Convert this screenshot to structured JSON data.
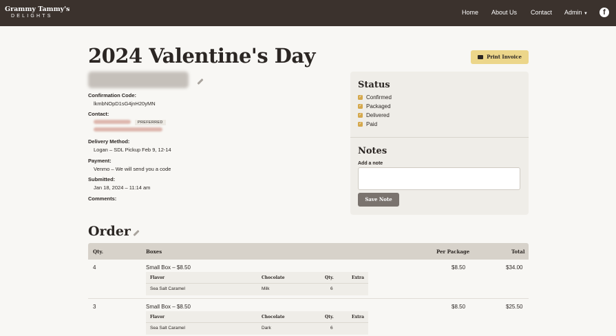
{
  "nav": {
    "brand_name": "Grammy Tammy's",
    "brand_sub": "DELIGHTS",
    "links": [
      "Home",
      "About Us",
      "Contact",
      "Admin"
    ],
    "facebook_glyph": "f"
  },
  "page": {
    "title": "2024 Valentine's Day",
    "print_label": "Print Invoice"
  },
  "order_info": {
    "confirmation_label": "Confirmation Code:",
    "confirmation_code": "lkmbNOpD1sG4jnH20yMN",
    "contact_label": "Contact:",
    "preferred_badge": "PREFERRED",
    "delivery_label": "Delivery Method:",
    "delivery_value": "Logan – SDL Pickup Feb 9, 12-14",
    "payment_label": "Payment:",
    "payment_value": "Venmo – We will send you a code",
    "submitted_label": "Submitted:",
    "submitted_value": "Jan 18, 2024 – 11:14 am",
    "comments_label": "Comments:"
  },
  "status": {
    "heading": "Status",
    "items": [
      "Confirmed",
      "Packaged",
      "Delivered",
      "Paid"
    ]
  },
  "notes": {
    "heading": "Notes",
    "add_label": "Add a note",
    "save_label": "Save Note"
  },
  "order": {
    "heading": "Order",
    "columns": [
      "Qty.",
      "Boxes",
      "Per Package",
      "Total"
    ],
    "sub_columns": [
      "Flavor",
      "Chocolate",
      "Qty.",
      "Extra"
    ],
    "rows": [
      {
        "qty": "4",
        "box": "Small Box – $8.50",
        "per_package": "$8.50",
        "total": "$34.00",
        "sub": {
          "flavor": "Sea Salt Caramel",
          "chocolate": "Milk",
          "qty": "6",
          "extra": ""
        }
      },
      {
        "qty": "3",
        "box": "Small Box – $8.50",
        "per_package": "$8.50",
        "total": "$25.50",
        "sub": {
          "flavor": "Sea Salt Caramel",
          "chocolate": "Dark",
          "qty": "6",
          "extra": ""
        }
      }
    ]
  }
}
